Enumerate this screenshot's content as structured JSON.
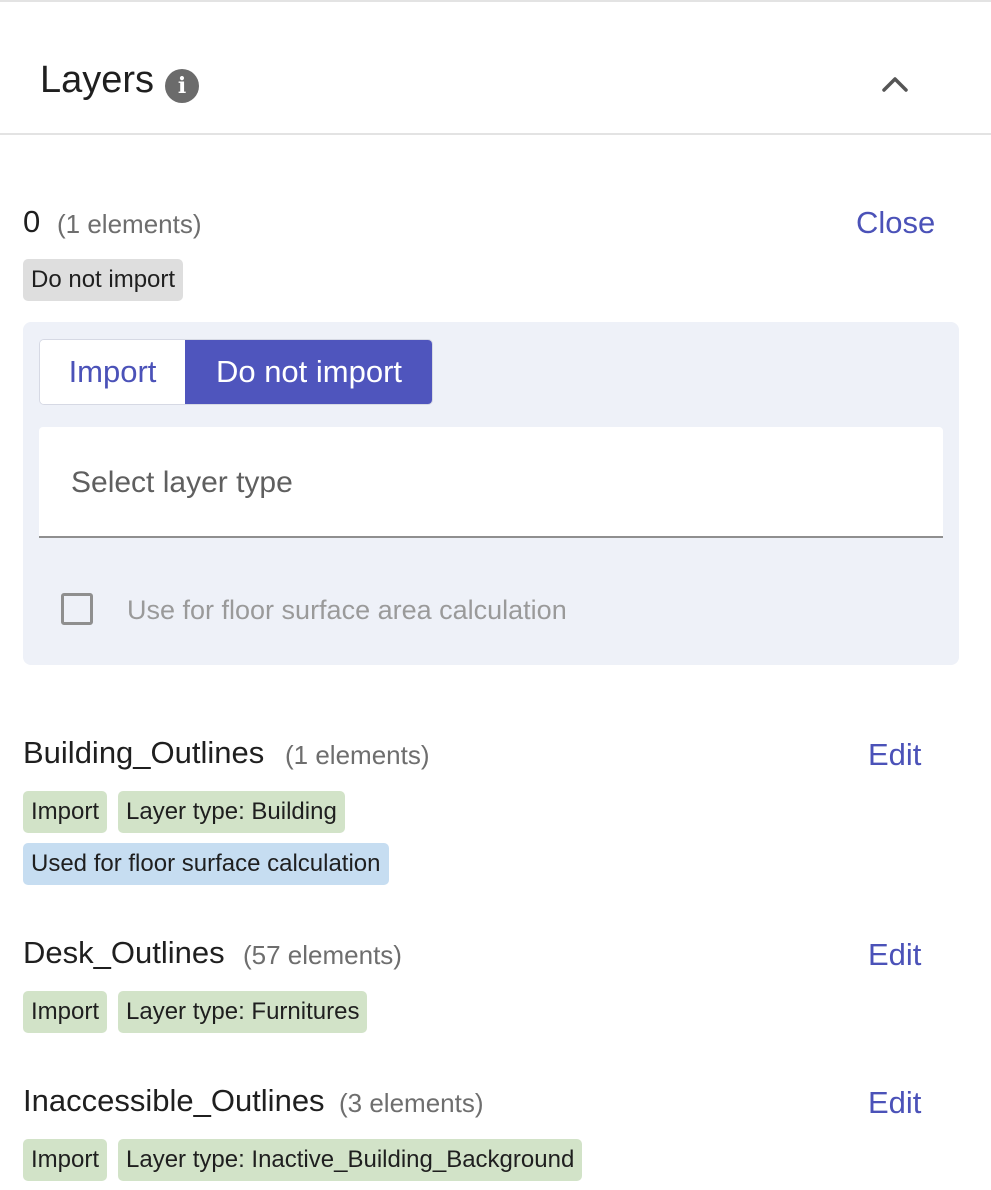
{
  "header": {
    "title": "Layers",
    "info_icon": "i"
  },
  "colors": {
    "accent": "#4f55bd",
    "link": "#4b52b8",
    "tag_grey": "#dedede",
    "tag_green": "#d2e3c8",
    "tag_blue": "#c6ddf1",
    "panel_bg": "#eef1f8"
  },
  "layers": [
    {
      "name": "0",
      "count": "(1 elements)",
      "action": "Close",
      "tags": [
        "Do not import"
      ],
      "editor": {
        "import_label": "Import",
        "skip_label": "Do not import",
        "selected": "Do not import",
        "select_placeholder": "Select layer type",
        "checkbox_label": "Use for floor surface area calculation",
        "checkbox_checked": false
      }
    },
    {
      "name": "Building_Outlines",
      "count": "(1 elements)",
      "action": "Edit",
      "tags": [
        "Import",
        "Layer type: Building",
        "Used for floor surface calculation"
      ]
    },
    {
      "name": "Desk_Outlines",
      "count": "(57 elements)",
      "action": "Edit",
      "tags": [
        "Import",
        "Layer type: Furnitures"
      ]
    },
    {
      "name": "Inaccessible_Outlines",
      "count": "(3 elements)",
      "action": "Edit",
      "tags": [
        "Import",
        "Layer type: Inactive_Building_Background"
      ]
    }
  ]
}
